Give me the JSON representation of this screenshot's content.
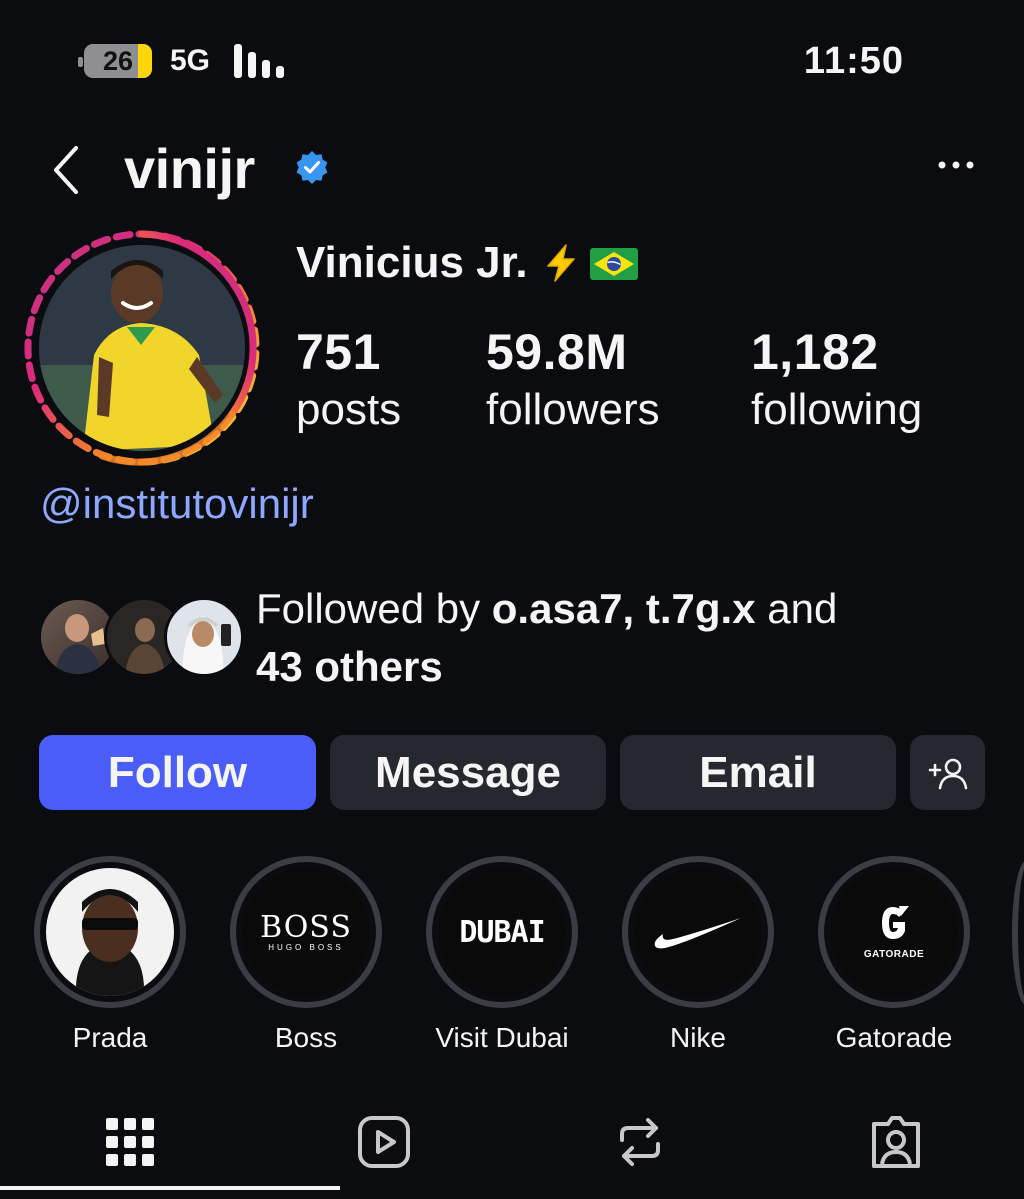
{
  "status_bar": {
    "battery_level": "26",
    "battery_fraction": 0.26,
    "network": "5G",
    "time": "11:50"
  },
  "header": {
    "username": "vinijr",
    "verified": true,
    "icons": [
      "back-icon",
      "verified-icon",
      "more-icon"
    ]
  },
  "profile": {
    "display_name": "Vinicius Jr.",
    "name_emojis": [
      "bolt-icon",
      "brazil-flag-icon"
    ],
    "stats": [
      {
        "value": "751",
        "label": "posts"
      },
      {
        "value": "59.8M",
        "label": "followers"
      },
      {
        "value": "1,182",
        "label": "following"
      }
    ],
    "link": "@institutovinijr"
  },
  "followed_by": {
    "prefix": "Followed by ",
    "names": "o.asa7, t.7g.x",
    "connector": " and",
    "others": "43 others"
  },
  "actions": {
    "follow": "Follow",
    "message": "Message",
    "email": "Email",
    "add_user_icon": "add-user-icon"
  },
  "highlights": [
    {
      "label": "Prada"
    },
    {
      "label": "Boss",
      "logo_line1": "BOSS",
      "logo_line2": "HUGO BOSS"
    },
    {
      "label": "Visit Dubai",
      "logo": "DUBAI"
    },
    {
      "label": "Nike"
    },
    {
      "label": "Gatorade",
      "logo": "GATORADE"
    }
  ],
  "tabs": [
    {
      "icon": "grid-icon",
      "active": true
    },
    {
      "icon": "reels-icon",
      "active": false
    },
    {
      "icon": "reposts-icon",
      "active": false
    },
    {
      "icon": "tagged-icon",
      "active": false
    }
  ],
  "colors": {
    "background": "#0b0c10",
    "follow_button": "#4a5df9",
    "secondary_button": "#262830",
    "link": "#8ea8ff",
    "verified": "#3797f0"
  }
}
